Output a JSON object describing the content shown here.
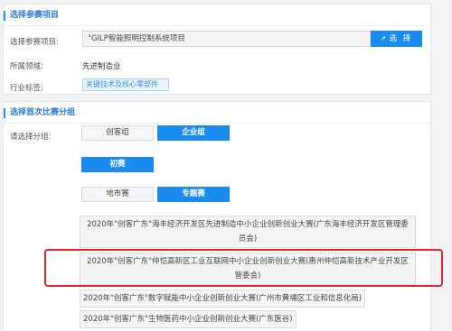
{
  "project_section": {
    "title": "选择参赛项目",
    "select_label": "选择参赛项目:",
    "select_value": "\"GILP智能照明控制系统项目",
    "select_button": "选 择",
    "select_icon": "cursor-icon",
    "field_label": "所属领域:",
    "field_value": "先进制造业",
    "tag_label": "行业标签:",
    "tag_value": "关键技术及核心零部件"
  },
  "contest_section": {
    "title": "选择首次比赛分组",
    "group_label": "请选择分组:",
    "group_options": [
      "创客组",
      "企业组"
    ],
    "selected_group": "企业组",
    "stage_button": "初赛",
    "type_options": [
      "地市赛",
      "专题赛"
    ],
    "selected_type": "专题赛",
    "competitions": [
      "2020年\"创客广东\"海丰经济开发区先进制造中小企业创新创业大赛(广东海丰经济开发区管理委员会)",
      "2020年\"创客广东\"仲恺高新区工业互联网中小企业创新创业大赛(惠州仲恺高新技术产业开发区管委会)",
      "2020年\"创客广东\"数字赋能中小企业创新创业大赛(广州市黄埔区工业和信息化局)",
      "2020年\"创客广东\"生物医药中小企业创新创业大赛(广东医谷)"
    ],
    "highlight_color": "#e0262a"
  }
}
